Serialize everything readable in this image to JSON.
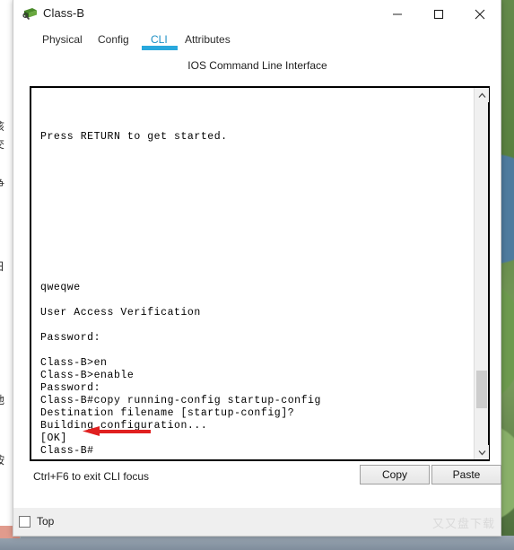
{
  "window": {
    "title": "Class-B",
    "icon": "switch-icon",
    "controls": {
      "minimize": "minimize-icon",
      "maximize": "maximize-icon",
      "close": "close-icon"
    }
  },
  "tabs": [
    {
      "label": "Physical",
      "active": false
    },
    {
      "label": "Config",
      "active": false
    },
    {
      "label": "CLI",
      "active": true
    },
    {
      "label": "Attributes",
      "active": false
    }
  ],
  "panel": {
    "title": "IOS Command Line Interface"
  },
  "terminal": {
    "lines": [
      "",
      "",
      "",
      "Press RETURN to get started.",
      "",
      "",
      "",
      "",
      "",
      "",
      "",
      "",
      "",
      "",
      "",
      "qweqwe",
      "",
      "User Access Verification",
      "",
      "Password:",
      "",
      "Class-B>en",
      "Class-B>enable",
      "Password:",
      "Class-B#copy running-config startup-config",
      "Destination filename [startup-config]?",
      "Building configuration...",
      "[OK]",
      "Class-B#"
    ],
    "annotation": {
      "type": "arrow-left",
      "color": "#e02020"
    },
    "scrollbar": {
      "up": "chevron-up-icon",
      "down": "chevron-down-icon",
      "position_percent": 88
    }
  },
  "footer": {
    "hint": "Ctrl+F6 to exit CLI focus",
    "copy_label": "Copy",
    "paste_label": "Paste"
  },
  "bottom": {
    "top_checkbox_label": "Top",
    "top_checked": false,
    "watermark": "又又盘下载"
  },
  "background_window": {
    "glyphs": [
      "该",
      "交",
      "争",
      "日",
      "他",
      "按"
    ]
  },
  "colors": {
    "accent": "#29a8dd",
    "active_tab_text": "#1b8fc4",
    "annotation_red": "#e02020",
    "terminal_bg": "#ffffff",
    "terminal_text": "#000000"
  }
}
